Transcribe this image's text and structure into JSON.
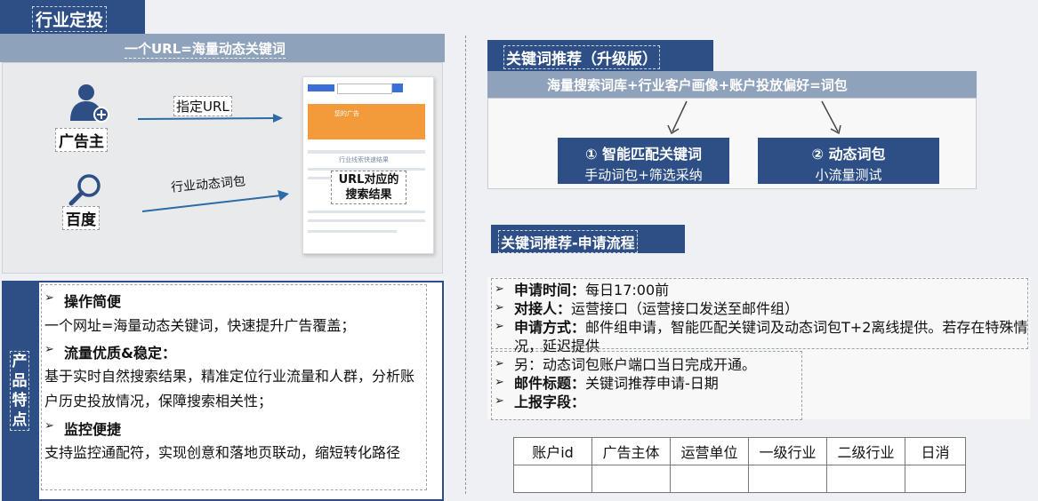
{
  "left": {
    "header": "行业定投",
    "banner": "一个URL=海量动态关键词",
    "advertiser_label": "广告主",
    "baidu_label": "百度",
    "arrow1_label": "指定URL",
    "arrow2_label": "行业动态词包",
    "mock": {
      "ad_text": "您的广告",
      "result_heading": "行业线索快速结果",
      "overlay": "URL对应的\n搜索结果"
    }
  },
  "features": {
    "side_label": "产品特点",
    "items": [
      {
        "title": "操作简便",
        "body": "一个网址=海量动态关键词，快速提升广告覆盖；"
      },
      {
        "title": "流量优质&稳定：",
        "body": "基于实时自然搜索结果，精准定位行业流量和人群，分析账户历史投放情况，保障搜索相关性；"
      },
      {
        "title": "监控便捷",
        "body": "支持监控通配符，实现创意和落地页联动，缩短转化路径"
      }
    ]
  },
  "right": {
    "title": "关键词推荐（升级版）",
    "formula": "海量搜索词库+行业客户画像+账户投放偏好=词包",
    "box1": {
      "title": "① 智能匹配关键词",
      "sub": "手动词包+筛选采纳"
    },
    "box2": {
      "title": "② 动态词包",
      "sub": "小流量测试"
    },
    "process_title": "关键词推荐-申请流程",
    "bullets": [
      {
        "label": "申请时间：",
        "text": "每日17:00前"
      },
      {
        "label": "对接人：",
        "text": "运营接口（运营接口发送至邮件组）"
      },
      {
        "label": "申请方式：",
        "text": "邮件组申请，智能匹配关键词及动态词包T+2离线提供。若存在特殊情况，延迟提供"
      },
      {
        "label": "",
        "text": "另：动态词包账户端口当日完成开通。"
      },
      {
        "label": "邮件标题：",
        "text": "关键词推荐申请-日期"
      },
      {
        "label": "上报字段：",
        "text": ""
      }
    ],
    "table_headers": [
      "账户id",
      "广告主体",
      "运营单位",
      "一级行业",
      "二级行业",
      "日消"
    ]
  },
  "colors": {
    "navy": "#2d4f86",
    "steel": "#8ea2bc"
  },
  "icons": [
    "person-plus-icon",
    "magnifier-icon",
    "arrow-icon"
  ]
}
